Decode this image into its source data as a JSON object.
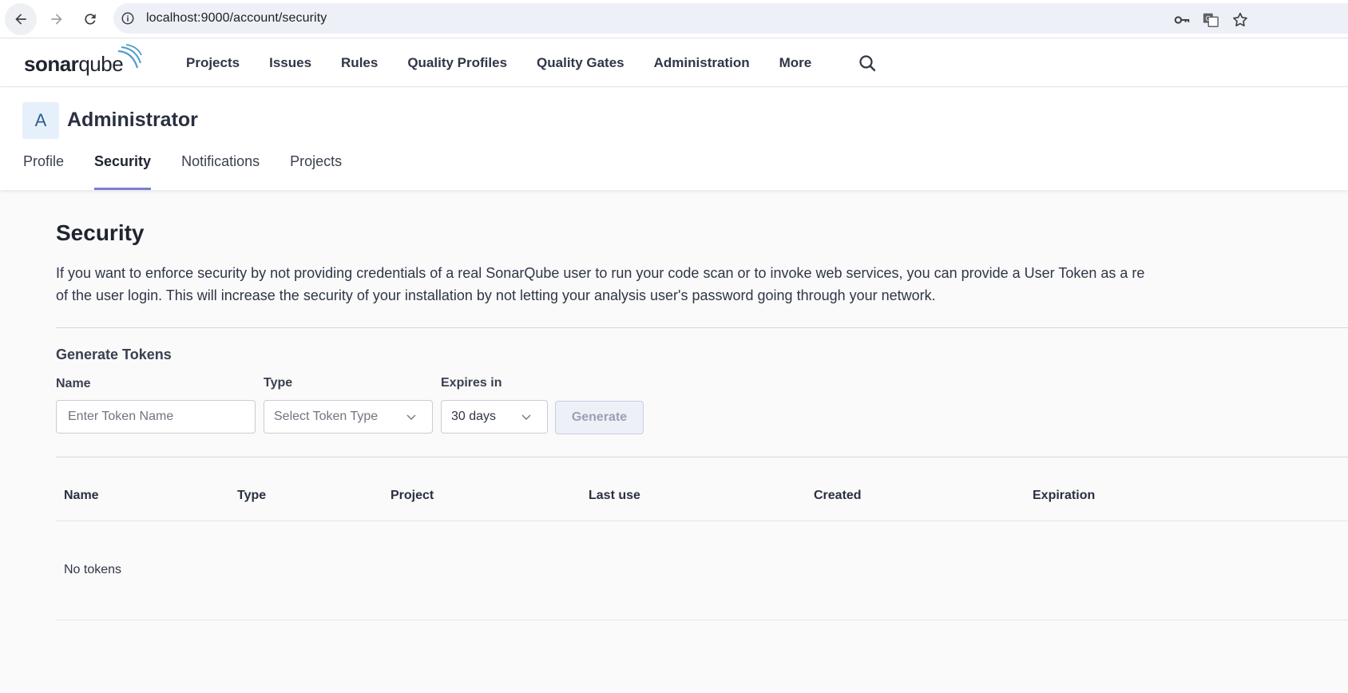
{
  "browser": {
    "url": "localhost:9000/account/security"
  },
  "header": {
    "logo_text_bold": "sonar",
    "logo_text_light": "qube",
    "nav": [
      {
        "label": "Projects"
      },
      {
        "label": "Issues"
      },
      {
        "label": "Rules"
      },
      {
        "label": "Quality Profiles"
      },
      {
        "label": "Quality Gates"
      },
      {
        "label": "Administration"
      },
      {
        "label": "More"
      }
    ]
  },
  "account": {
    "avatar_letter": "A",
    "name": "Administrator",
    "tabs": [
      {
        "label": "Profile",
        "active": false
      },
      {
        "label": "Security",
        "active": true
      },
      {
        "label": "Notifications",
        "active": false
      },
      {
        "label": "Projects",
        "active": false
      }
    ]
  },
  "security": {
    "title": "Security",
    "description_line1": "If you want to enforce security by not providing credentials of a real SonarQube user to run your code scan or to invoke web services, you can provide a User Token as a re",
    "description_line2": "of the user login. This will increase the security of your installation by not letting your analysis user's password going through your network.",
    "generate": {
      "title": "Generate Tokens",
      "name_label": "Name",
      "name_placeholder": "Enter Token Name",
      "name_value": "",
      "type_label": "Type",
      "type_placeholder": "Select Token Type",
      "expires_label": "Expires in",
      "expires_value": "30 days",
      "button_label": "Generate"
    },
    "table": {
      "columns": [
        "Name",
        "Type",
        "Project",
        "Last use",
        "Created",
        "Expiration"
      ],
      "empty_text": "No tokens"
    }
  },
  "colors": {
    "accent": "#7b7fd1",
    "avatar_bg": "#e6f0fb"
  }
}
